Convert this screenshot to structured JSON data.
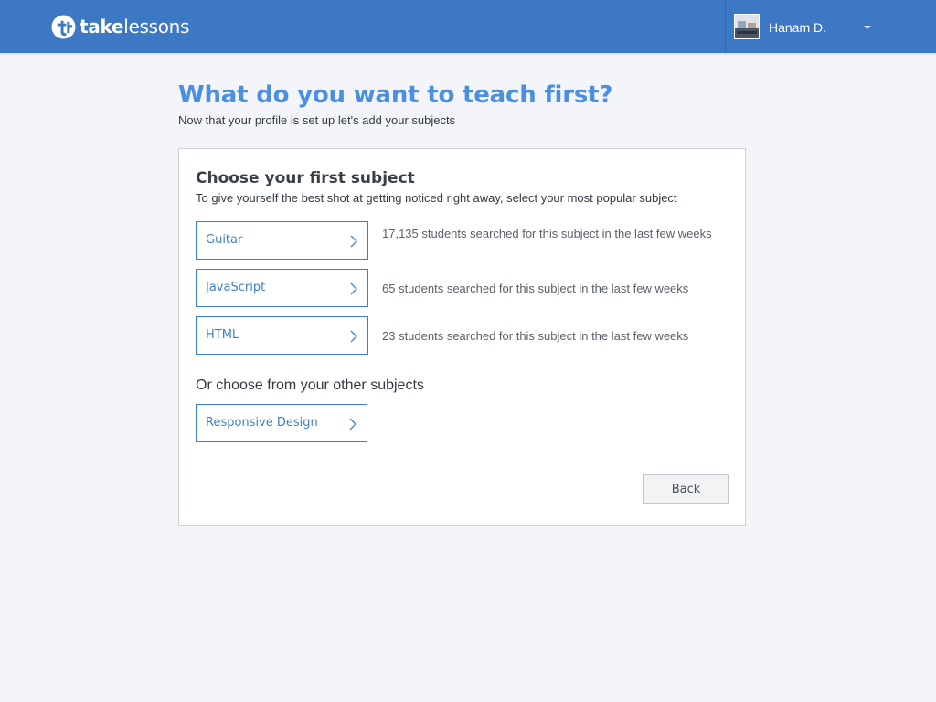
{
  "header": {
    "brand_bold": "take",
    "brand_light": "lessons",
    "user_name": "Hanam D.",
    "accent": "#3d78c4"
  },
  "main": {
    "title": "What do you want to teach first?",
    "subtitle": "Now that your profile is set up let's add your subjects"
  },
  "card": {
    "title": "Choose your first subject",
    "description": "To give yourself the best shot at getting noticed right away, select your most popular subject",
    "subjects": [
      {
        "label": "Guitar",
        "info": "17,135 students searched for this subject in the last few weeks"
      },
      {
        "label": "JavaScript",
        "info": "65 students searched for this subject in the last few weeks"
      },
      {
        "label": "HTML",
        "info": "23 students searched for this subject in the last few weeks"
      }
    ],
    "other_title": "Or choose from your other subjects",
    "other_subjects": [
      {
        "label": "Responsive Design"
      }
    ],
    "back_label": "Back"
  }
}
